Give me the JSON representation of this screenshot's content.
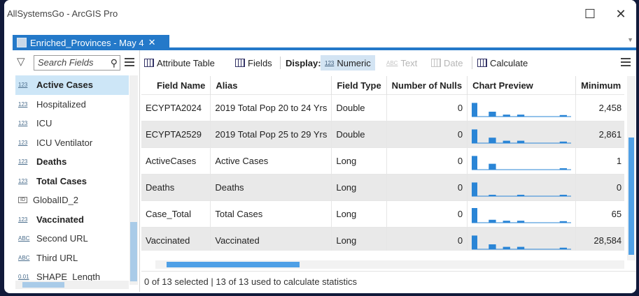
{
  "window": {
    "title": "AllSystemsGo - ArcGIS Pro"
  },
  "doc_tab": {
    "label": "Enriched_Provinces - May 4"
  },
  "search": {
    "placeholder": "Search Fields"
  },
  "fields": [
    {
      "type_icon": "123",
      "name": "Active Cases",
      "bold": true,
      "selected": true
    },
    {
      "type_icon": "123",
      "name": "Hospitalized",
      "bold": false
    },
    {
      "type_icon": "123",
      "name": "ICU",
      "bold": false
    },
    {
      "type_icon": "123",
      "name": "ICU Ventilator",
      "bold": false
    },
    {
      "type_icon": "123",
      "name": "Deaths",
      "bold": true
    },
    {
      "type_icon": "123",
      "name": "Total Cases",
      "bold": true
    },
    {
      "type_icon": "ID",
      "name": "GlobalID_2",
      "bold": false
    },
    {
      "type_icon": "123",
      "name": "Vaccinated",
      "bold": true
    },
    {
      "type_icon": "ABC",
      "name": "Second URL",
      "bold": false
    },
    {
      "type_icon": "ABC",
      "name": "Third URL",
      "bold": false
    },
    {
      "type_icon": "0.01",
      "name": "SHAPE_Length",
      "bold": false
    }
  ],
  "toolbar": {
    "attribute_table": "Attribute Table",
    "fields": "Fields",
    "display_label": "Display:",
    "numeric": "Numeric",
    "numeric_icon": "123",
    "text": "Text",
    "text_icon": "ABC",
    "date": "Date",
    "calculate": "Calculate"
  },
  "table": {
    "columns": [
      "Field Name",
      "Alias",
      "Field Type",
      "Number of Nulls",
      "Chart Preview",
      "Minimum"
    ],
    "rows": [
      {
        "field_name": "ECYPTA2024",
        "alias": "2019 Total Pop 20 to 24 Yrs",
        "field_type": "Double",
        "nulls": "0",
        "minimum": "2,458",
        "hist": [
          0.7,
          0.25,
          0.1,
          0.1,
          0,
          0,
          0.08
        ]
      },
      {
        "field_name": "ECYPTA2529",
        "alias": "2019 Total Pop 25 to 29 Yrs",
        "field_type": "Double",
        "nulls": "0",
        "minimum": "2,861",
        "hist": [
          0.7,
          0.28,
          0.12,
          0.12,
          0,
          0,
          0.08
        ]
      },
      {
        "field_name": "ActiveCases",
        "alias": "Active Cases",
        "field_type": "Long",
        "nulls": "0",
        "minimum": "1",
        "hist": [
          0.7,
          0.3,
          0,
          0,
          0,
          0,
          0.06
        ]
      },
      {
        "field_name": "Deaths",
        "alias": "Deaths",
        "field_type": "Long",
        "nulls": "0",
        "minimum": "0",
        "hist": [
          0.7,
          0.05,
          0,
          0.05,
          0,
          0,
          0.05
        ]
      },
      {
        "field_name": "Case_Total",
        "alias": "Total Cases",
        "field_type": "Long",
        "nulls": "0",
        "minimum": "65",
        "hist": [
          0.75,
          0.15,
          0.1,
          0.1,
          0,
          0,
          0.08
        ]
      },
      {
        "field_name": "Vaccinated",
        "alias": "Vaccinated",
        "field_type": "Long",
        "nulls": "0",
        "minimum": "28,584",
        "hist": [
          0.7,
          0.25,
          0.12,
          0.12,
          0,
          0,
          0.08
        ]
      }
    ]
  },
  "status": {
    "text": "0 of 13 selected | 13 of 13 used to calculate statistics"
  },
  "colors": {
    "accent": "#2479c9",
    "histogram": "#2a85d6",
    "selection": "#cde6f7"
  }
}
